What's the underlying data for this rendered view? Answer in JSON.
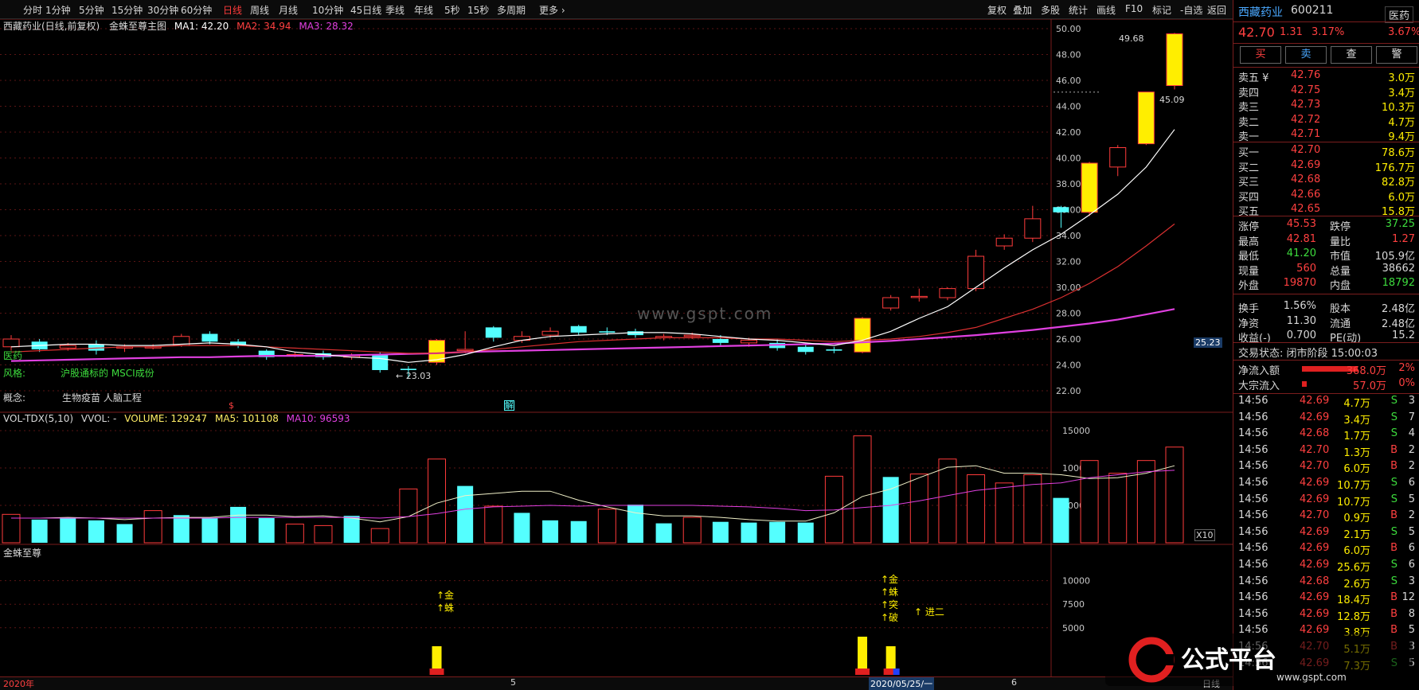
{
  "toolbar": {
    "periods": [
      "分时",
      "1分钟",
      "5分钟",
      "15分钟",
      "30分钟",
      "60分钟",
      "日线",
      "周线",
      "月线",
      "10分钟",
      "45日线",
      "季线",
      "年线",
      "5秒",
      "15秒",
      "多周期",
      "更多 ›"
    ],
    "active": "日线",
    "right": [
      "复权",
      "叠加",
      "多股",
      "统计",
      "画线",
      "F10",
      "标记",
      "-自选",
      "返回"
    ]
  },
  "chart_info": {
    "stock_label": "西藏药业(日线,前复权)",
    "indicator": "金蛛至尊主图",
    "ma1": "MA1: 42.20",
    "ma2": "MA2: 34.94",
    "ma3": "MA3: 28.32",
    "vol_line": "VOL-TDX(5,10)",
    "vvol": "VVOL: -",
    "volume": "VOLUME: 129247",
    "ma5": "MA5: 101108",
    "ma10": "MA10: 96593",
    "bottom_title": "金蛛至尊",
    "sector": "医药",
    "style_label": "风格:",
    "style_value": "沪股通标的 MSCI成份",
    "concept_label": "概念:",
    "concept_value": "生物疫苗 人脑工程",
    "high_label": "49.68",
    "low_label": "← 23.03",
    "price_tag": "25.23",
    "cur_tag": "45.09",
    "x10": "X10",
    "mark_s": "$",
    "mark_jie": "解",
    "watermark": "www.gspt.com",
    "date_left": "2020年",
    "date_5": "5",
    "date_6": "6",
    "date_cursor": "2020/05/25/一",
    "date_right": "日线",
    "signal1": [
      "↑金",
      "↑蛛"
    ],
    "signal2": [
      "↑金",
      "↑蛛",
      "↑突",
      "↑破"
    ],
    "signal3": "↑ 进二",
    "logo_text": "公式平台",
    "logo_url": "www.gspt.com"
  },
  "colors": {
    "up": "#ff3b3b",
    "down": "#54ffff",
    "ma1": "#ffffff",
    "ma2": "#d93030",
    "ma3": "#e040e0",
    "yellow": "#ffee00"
  },
  "chart_data": {
    "type": "candlestick",
    "price_ylim": [
      21.5,
      51
    ],
    "price_ticks": [
      "50.00",
      "48.00",
      "46.00",
      "44.00",
      "42.00",
      "40.00",
      "38.00",
      "36.00",
      "34.00",
      "32.00",
      "30.00",
      "28.00",
      "26.00",
      "24.00",
      "22.00"
    ],
    "vol_ticks": [
      "15000",
      "10000",
      "5000"
    ],
    "sig_ticks": [
      "10000",
      "7500",
      "5000"
    ],
    "candles": [
      {
        "o": 25.4,
        "c": 26.0,
        "h": 26.3,
        "l": 25.1
      },
      {
        "o": 25.8,
        "c": 25.2,
        "h": 26.0,
        "l": 25.0
      },
      {
        "o": 25.3,
        "c": 25.5,
        "h": 25.7,
        "l": 25.1
      },
      {
        "o": 25.6,
        "c": 25.1,
        "h": 25.9,
        "l": 24.8
      },
      {
        "o": 25.3,
        "c": 25.4,
        "h": 25.6,
        "l": 25.0
      },
      {
        "o": 25.4,
        "c": 25.4,
        "h": 25.6,
        "l": 25.2
      },
      {
        "o": 25.5,
        "c": 26.2,
        "h": 26.4,
        "l": 25.4
      },
      {
        "o": 26.4,
        "c": 25.8,
        "h": 26.6,
        "l": 25.6
      },
      {
        "o": 25.8,
        "c": 25.5,
        "h": 26.0,
        "l": 25.3
      },
      {
        "o": 25.1,
        "c": 24.6,
        "h": 25.2,
        "l": 24.4
      },
      {
        "o": 24.8,
        "c": 24.8,
        "h": 25.0,
        "l": 24.6
      },
      {
        "o": 24.9,
        "c": 24.6,
        "h": 25.1,
        "l": 24.4
      },
      {
        "o": 24.6,
        "c": 24.7,
        "h": 24.9,
        "l": 24.4
      },
      {
        "o": 24.8,
        "c": 23.6,
        "h": 25.0,
        "l": 23.4
      },
      {
        "o": 23.7,
        "c": 23.6,
        "h": 23.9,
        "l": 23.0
      },
      {
        "o": 24.2,
        "c": 25.9,
        "h": 26.0,
        "l": 24.0
      },
      {
        "o": 25.1,
        "c": 25.2,
        "h": 26.6,
        "l": 24.9
      },
      {
        "o": 26.9,
        "c": 26.1,
        "h": 27.0,
        "l": 25.8
      },
      {
        "o": 25.9,
        "c": 26.2,
        "h": 26.6,
        "l": 25.7
      },
      {
        "o": 26.3,
        "c": 26.6,
        "h": 26.9,
        "l": 26.1
      },
      {
        "o": 27.0,
        "c": 26.5,
        "h": 27.1,
        "l": 26.3
      },
      {
        "o": 26.6,
        "c": 26.5,
        "h": 26.9,
        "l": 26.3
      },
      {
        "o": 26.6,
        "c": 26.3,
        "h": 26.8,
        "l": 26.1
      },
      {
        "o": 26.1,
        "c": 26.2,
        "h": 26.4,
        "l": 25.9
      },
      {
        "o": 26.2,
        "c": 26.3,
        "h": 26.5,
        "l": 26.0
      },
      {
        "o": 26.0,
        "c": 25.7,
        "h": 26.3,
        "l": 25.5
      },
      {
        "o": 25.7,
        "c": 25.9,
        "h": 26.1,
        "l": 25.4
      },
      {
        "o": 25.7,
        "c": 25.3,
        "h": 26.0,
        "l": 25.1
      },
      {
        "o": 25.4,
        "c": 25.0,
        "h": 25.6,
        "l": 24.8
      },
      {
        "o": 25.2,
        "c": 25.1,
        "h": 25.4,
        "l": 24.9
      },
      {
        "o": 25.0,
        "c": 27.6,
        "h": 27.7,
        "l": 24.9
      },
      {
        "o": 28.4,
        "c": 29.2,
        "h": 29.4,
        "l": 28.2
      },
      {
        "o": 29.3,
        "c": 29.3,
        "h": 29.9,
        "l": 28.9
      },
      {
        "o": 29.2,
        "c": 29.9,
        "h": 30.0,
        "l": 29.0
      },
      {
        "o": 29.9,
        "c": 32.4,
        "h": 32.9,
        "l": 29.7
      },
      {
        "o": 33.2,
        "c": 33.8,
        "h": 34.1,
        "l": 32.9
      },
      {
        "o": 33.8,
        "c": 35.3,
        "h": 36.3,
        "l": 33.5
      },
      {
        "o": 36.2,
        "c": 35.8,
        "h": 36.3,
        "l": 34.6
      },
      {
        "o": 35.8,
        "c": 39.6,
        "h": 39.7,
        "l": 35.5
      },
      {
        "o": 39.3,
        "c": 40.8,
        "h": 41.0,
        "l": 38.6
      },
      {
        "o": 41.1,
        "c": 45.1,
        "h": 45.1,
        "l": 41.0
      },
      {
        "o": 45.6,
        "c": 49.6,
        "h": 49.68,
        "l": 45.3
      }
    ],
    "volume": [
      3800,
      3100,
      3300,
      3000,
      2500,
      4300,
      3700,
      3300,
      4800,
      3300,
      2500,
      2300,
      3600,
      1900,
      7200,
      11200,
      7600,
      4900,
      4000,
      3000,
      2900,
      4500,
      5100,
      2600,
      3400,
      2800,
      2700,
      2800,
      2700,
      8900,
      14300,
      8800,
      9200,
      11200,
      9100,
      8000,
      9100,
      6000,
      11000,
      9300,
      11000,
      12800
    ],
    "vol_up": [
      true,
      false,
      false,
      false,
      false,
      true,
      false,
      false,
      false,
      false,
      true,
      true,
      false,
      true,
      true,
      true,
      false,
      true,
      false,
      false,
      false,
      true,
      false,
      false,
      true,
      false,
      false,
      false,
      false,
      true,
      true,
      false,
      true,
      true,
      true,
      true,
      true,
      false,
      true,
      true,
      true,
      true
    ],
    "ma1": [
      25.4,
      25.5,
      25.6,
      25.6,
      25.5,
      25.5,
      25.6,
      25.7,
      25.6,
      25.4,
      25.0,
      24.8,
      24.6,
      24.5,
      24.2,
      24.4,
      24.8,
      25.4,
      25.9,
      26.2,
      26.3,
      26.4,
      26.5,
      26.5,
      26.4,
      26.2,
      26.0,
      25.9,
      25.7,
      25.5,
      25.9,
      26.6,
      27.6,
      28.5,
      30.0,
      31.5,
      32.9,
      34.1,
      35.6,
      37.2,
      39.3,
      42.2
    ],
    "ma2": [
      25.0,
      25.1,
      25.2,
      25.3,
      25.4,
      25.4,
      25.5,
      25.5,
      25.5,
      25.4,
      25.3,
      25.2,
      25.1,
      25.0,
      24.9,
      24.9,
      25.0,
      25.2,
      25.4,
      25.6,
      25.8,
      25.9,
      26.0,
      26.1,
      26.1,
      26.1,
      26.0,
      26.0,
      25.9,
      25.8,
      25.9,
      26.0,
      26.2,
      26.5,
      26.9,
      27.6,
      28.3,
      29.2,
      30.3,
      31.6,
      33.2,
      34.9
    ],
    "ma3": [
      24.3,
      24.35,
      24.4,
      24.45,
      24.5,
      24.55,
      24.6,
      24.6,
      24.65,
      24.7,
      24.7,
      24.7,
      24.75,
      24.8,
      24.85,
      24.9,
      25.0,
      25.05,
      25.1,
      25.15,
      25.2,
      25.25,
      25.3,
      25.35,
      25.4,
      25.45,
      25.5,
      25.55,
      25.6,
      25.65,
      25.75,
      25.85,
      26.0,
      26.15,
      26.3,
      26.5,
      26.7,
      26.95,
      27.2,
      27.5,
      27.9,
      28.32
    ],
    "vma5": [
      3300,
      3300,
      3400,
      3300,
      3100,
      3300,
      3400,
      3400,
      3700,
      3700,
      3500,
      3600,
      3300,
      2800,
      3500,
      5300,
      6300,
      6600,
      6900,
      6900,
      5700,
      4800,
      4000,
      3600,
      3600,
      3400,
      3100,
      2900,
      2900,
      4000,
      6200,
      7200,
      8700,
      10100,
      10300,
      9300,
      9300,
      9100,
      8600,
      8700,
      9300,
      10300
    ],
    "vma10": [
      3300,
      3300,
      3300,
      3300,
      3300,
      3300,
      3300,
      3300,
      3400,
      3400,
      3400,
      3400,
      3400,
      3300,
      3500,
      3900,
      4500,
      4800,
      4900,
      5000,
      4900,
      5000,
      5000,
      5000,
      5000,
      4900,
      4800,
      4600,
      4300,
      4400,
      4700,
      5000,
      5600,
      6300,
      7000,
      7400,
      7800,
      8000,
      8700,
      9100,
      9500,
      9700
    ]
  },
  "quote": {
    "name": "西藏药业",
    "code": "600211",
    "sector": "医药",
    "price": "42.70",
    "change": "1.31",
    "pct": "3.17%",
    "sector_pct": "3.67%",
    "buttons": [
      "买",
      "卖",
      "查",
      "警"
    ],
    "asks": [
      {
        "l": "卖五 ¥",
        "p": "42.76",
        "v": "3.0万"
      },
      {
        "l": "卖四",
        "p": "42.75",
        "v": "3.4万"
      },
      {
        "l": "卖三",
        "p": "42.73",
        "v": "10.3万"
      },
      {
        "l": "卖二",
        "p": "42.72",
        "v": "4.7万"
      },
      {
        "l": "卖一",
        "p": "42.71",
        "v": "9.4万"
      }
    ],
    "bids": [
      {
        "l": "买一",
        "p": "42.70",
        "v": "78.6万"
      },
      {
        "l": "买二",
        "p": "42.69",
        "v": "176.7万"
      },
      {
        "l": "买三",
        "p": "42.68",
        "v": "82.8万"
      },
      {
        "l": "买四",
        "p": "42.66",
        "v": "6.0万"
      },
      {
        "l": "买五",
        "p": "42.65",
        "v": "15.8万"
      }
    ],
    "stats": [
      {
        "a": "涨停",
        "av": "45.53",
        "ac": "r",
        "b": "跌停",
        "bv": "37.25",
        "bc": "g"
      },
      {
        "a": "最高",
        "av": "42.81",
        "ac": "r",
        "b": "量比",
        "bv": "1.27",
        "bc": "r"
      },
      {
        "a": "最低",
        "av": "41.20",
        "ac": "g",
        "b": "市值",
        "bv": "105.9亿",
        "bc": "w"
      },
      {
        "a": "现量",
        "av": "560",
        "ac": "r",
        "b": "总量",
        "bv": "38662",
        "bc": "w"
      },
      {
        "a": "外盘",
        "av": "19870",
        "ac": "r",
        "b": "内盘",
        "bv": "18792",
        "bc": "g"
      },
      {
        "a": "换手",
        "av": "1.56%",
        "ac": "w",
        "b": "股本",
        "bv": "2.48亿",
        "bc": "w"
      },
      {
        "a": "净资",
        "av": "11.30",
        "ac": "w",
        "b": "流通",
        "bv": "2.48亿",
        "bc": "w"
      },
      {
        "a": "收益(-)",
        "av": "0.700",
        "ac": "w",
        "b": "PE(动)",
        "bv": "15.2",
        "bc": "w"
      }
    ],
    "trade_state": "交易状态: 闭市阶段 15:00:03",
    "flow": [
      {
        "l": "净流入额",
        "v": "368.0万",
        "p": "2%",
        "bar": 70
      },
      {
        "l": "大宗流入",
        "v": "57.0万",
        "p": "0%",
        "bar": 6
      }
    ],
    "ticks": [
      {
        "t": "14:56",
        "p": "42.69",
        "v": "4.7万",
        "s": "S",
        "n": "3"
      },
      {
        "t": "14:56",
        "p": "42.69",
        "v": "3.4万",
        "s": "S",
        "n": "7"
      },
      {
        "t": "14:56",
        "p": "42.68",
        "v": "1.7万",
        "s": "S",
        "n": "4"
      },
      {
        "t": "14:56",
        "p": "42.70",
        "v": "1.3万",
        "s": "B",
        "n": "2"
      },
      {
        "t": "14:56",
        "p": "42.70",
        "v": "6.0万",
        "s": "B",
        "n": "2"
      },
      {
        "t": "14:56",
        "p": "42.69",
        "v": "10.7万",
        "s": "S",
        "n": "6"
      },
      {
        "t": "14:56",
        "p": "42.69",
        "v": "10.7万",
        "s": "S",
        "n": "5"
      },
      {
        "t": "14:56",
        "p": "42.70",
        "v": "0.9万",
        "s": "B",
        "n": "2"
      },
      {
        "t": "14:56",
        "p": "42.69",
        "v": "2.1万",
        "s": "S",
        "n": "5"
      },
      {
        "t": "14:56",
        "p": "42.69",
        "v": "6.0万",
        "s": "B",
        "n": "6"
      },
      {
        "t": "14:56",
        "p": "42.69",
        "v": "25.6万",
        "s": "S",
        "n": "6"
      },
      {
        "t": "14:56",
        "p": "42.68",
        "v": "2.6万",
        "s": "S",
        "n": "3"
      },
      {
        "t": "14:56",
        "p": "42.69",
        "v": "18.4万",
        "s": "B",
        "n": "12"
      },
      {
        "t": "14:56",
        "p": "42.69",
        "v": "12.8万",
        "s": "B",
        "n": "8"
      },
      {
        "t": "14:56",
        "p": "42.69",
        "v": "3.8万",
        "s": "B",
        "n": "5"
      },
      {
        "t": "14:56",
        "p": "42.70",
        "v": "5.1万",
        "s": "B",
        "n": "3"
      },
      {
        "t": "14:56",
        "p": "42.69",
        "v": "7.3万",
        "s": "S",
        "n": "5"
      }
    ]
  }
}
